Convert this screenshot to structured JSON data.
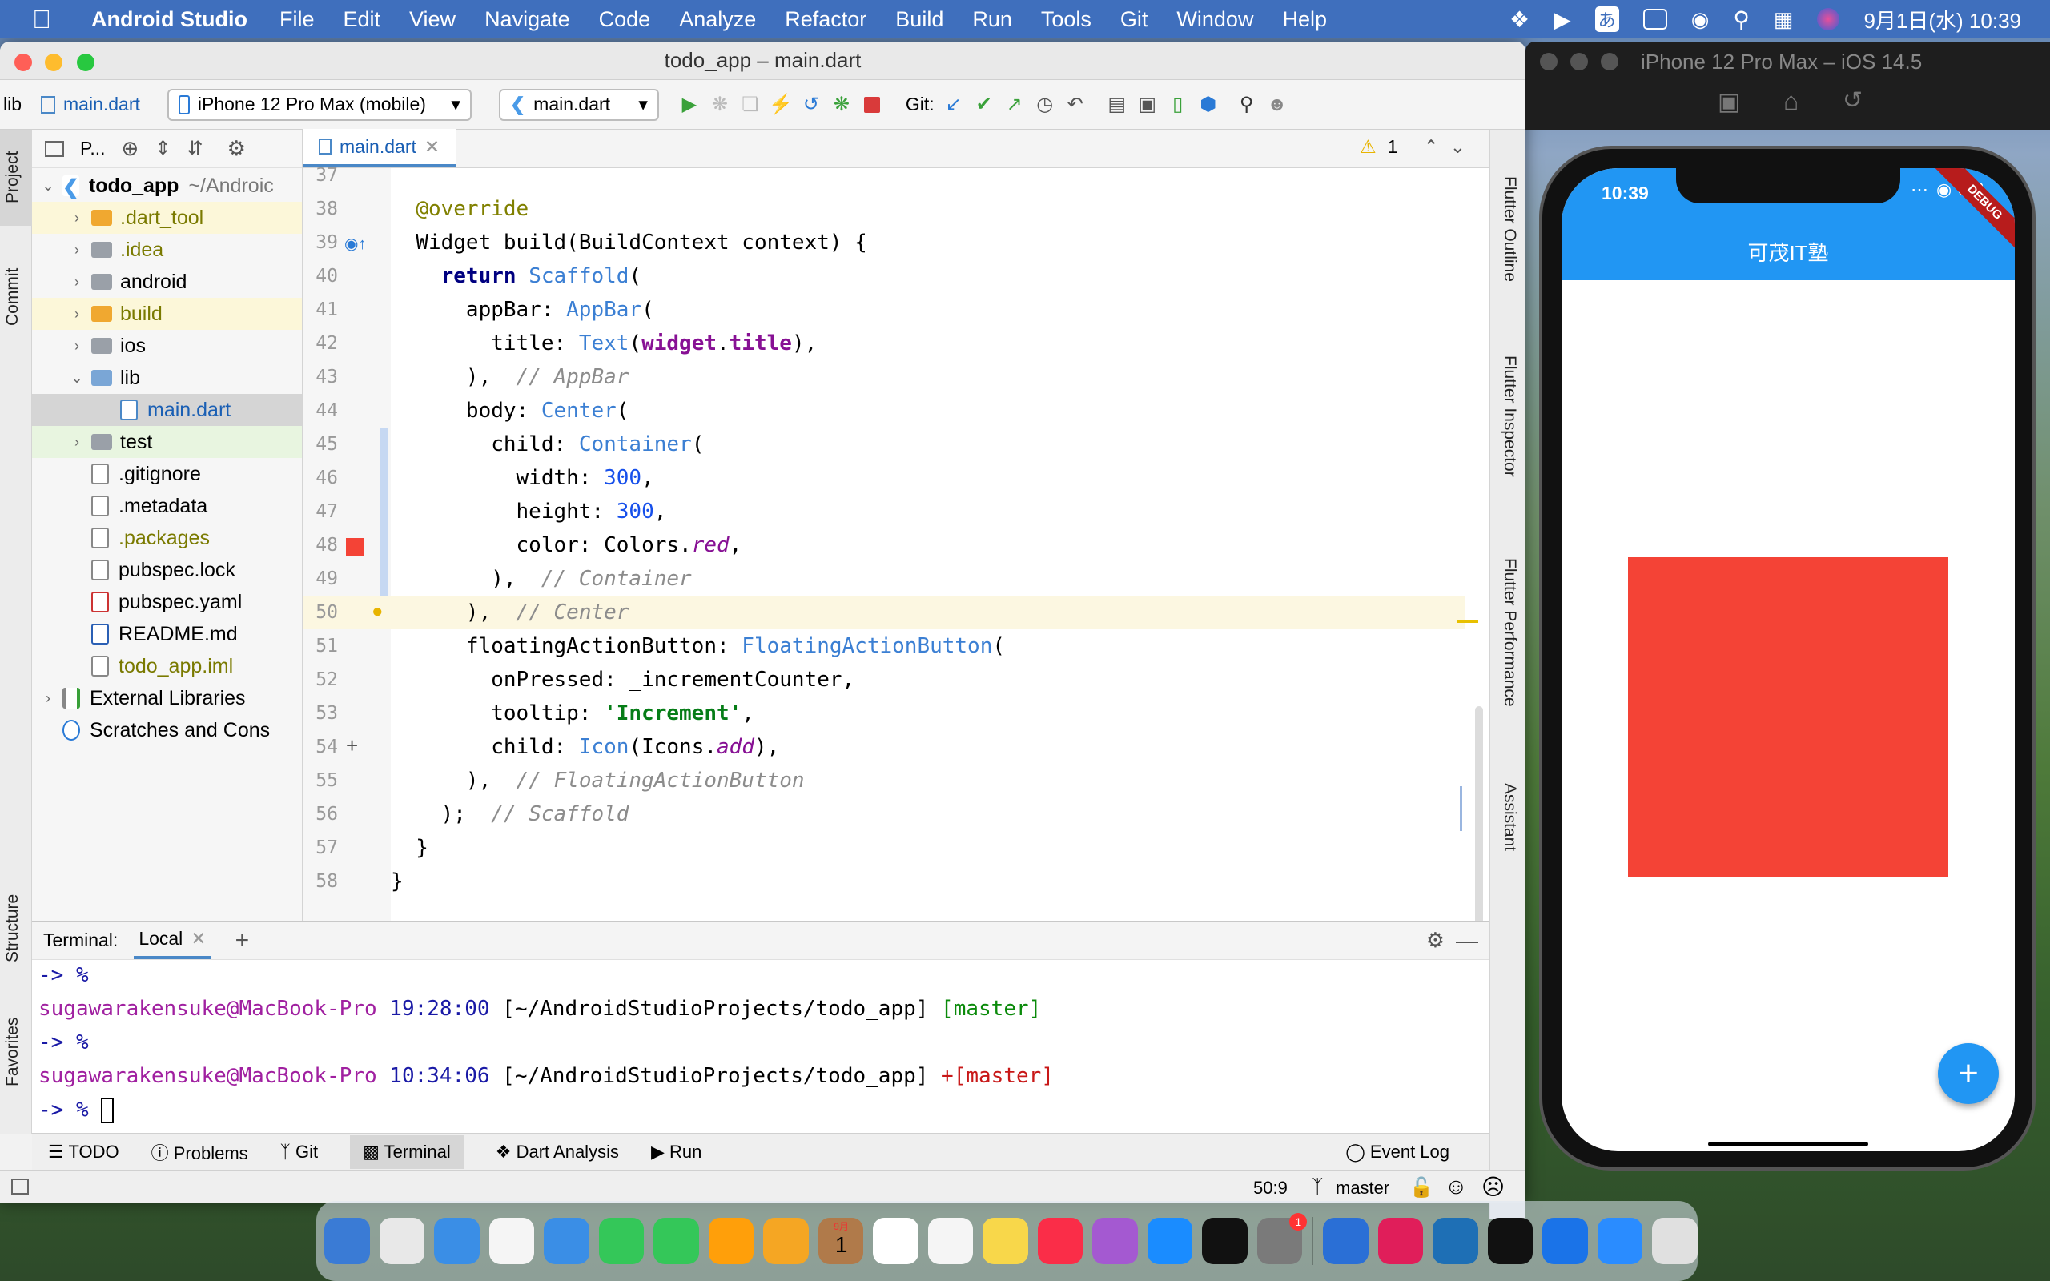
{
  "menubar": {
    "app": "Android Studio",
    "items": [
      "File",
      "Edit",
      "View",
      "Navigate",
      "Code",
      "Analyze",
      "Refactor",
      "Build",
      "Run",
      "Tools",
      "Git",
      "Window",
      "Help"
    ],
    "ime": "あ",
    "clock": "9月1日(水)  10:39"
  },
  "window": {
    "title": "todo_app – main.dart"
  },
  "toolbar": {
    "crumb_dir": "lib",
    "crumb_file": "main.dart",
    "device": "iPhone 12 Pro Max (mobile)",
    "run_config": "main.dart",
    "git_label": "Git:"
  },
  "left_tabs": {
    "project": "Project",
    "commit": "Commit",
    "structure": "Structure",
    "favorites": "Favorites"
  },
  "project_panel": {
    "header": "P...",
    "tree": [
      {
        "label": "todo_app",
        "extra": "~/Androic",
        "depth": 0,
        "arrow": "open",
        "icon": "flutter",
        "bold": true
      },
      {
        "label": ".dart_tool",
        "depth": 1,
        "arrow": "closed",
        "icon": "folder-orange",
        "color": "#7a7a00",
        "hl": "#fcf7d9"
      },
      {
        "label": ".idea",
        "depth": 1,
        "arrow": "closed",
        "icon": "folder-grey",
        "color": "#7a7a00"
      },
      {
        "label": "android",
        "depth": 1,
        "arrow": "closed",
        "icon": "folder-grey"
      },
      {
        "label": "build",
        "depth": 1,
        "arrow": "closed",
        "icon": "folder-orange",
        "color": "#7a7a00",
        "hl": "#fcf7d9"
      },
      {
        "label": "ios",
        "depth": 1,
        "arrow": "closed",
        "icon": "folder-grey"
      },
      {
        "label": "lib",
        "depth": 1,
        "arrow": "open",
        "icon": "folder-blue"
      },
      {
        "label": "main.dart",
        "depth": 2,
        "icon": "dart-file",
        "color": "#1a5fb4",
        "hl": "#d5d5d5"
      },
      {
        "label": "test",
        "depth": 1,
        "arrow": "closed",
        "icon": "folder-green",
        "hl": "#e8f5e0"
      },
      {
        "label": ".gitignore",
        "depth": 1,
        "icon": "file"
      },
      {
        "label": ".metadata",
        "depth": 1,
        "icon": "file"
      },
      {
        "label": ".packages",
        "depth": 1,
        "icon": "file",
        "color": "#7a7a00"
      },
      {
        "label": "pubspec.lock",
        "depth": 1,
        "icon": "file"
      },
      {
        "label": "pubspec.yaml",
        "depth": 1,
        "icon": "yaml-file"
      },
      {
        "label": "README.md",
        "depth": 1,
        "icon": "md-file"
      },
      {
        "label": "todo_app.iml",
        "depth": 1,
        "icon": "file",
        "color": "#7a7a00"
      },
      {
        "label": "External Libraries",
        "depth": 0,
        "arrow": "closed",
        "icon": "library"
      },
      {
        "label": "Scratches and Cons",
        "depth": 0,
        "icon": "scratch"
      }
    ]
  },
  "editor": {
    "tab": "main.dart",
    "warning_count": "1",
    "lines": [
      {
        "n": "37",
        "html": ""
      },
      {
        "n": "38",
        "html": "  <span class='an'>@override</span>"
      },
      {
        "n": "39",
        "html": "  Widget build(BuildContext context) {"
      },
      {
        "n": "40",
        "html": "    <span class='kw'>return</span> <span class='ty'>Scaffold</span>("
      },
      {
        "n": "41",
        "html": "      appBar: <span class='ty'>AppBar</span>("
      },
      {
        "n": "42",
        "html": "        title: <span class='ty'>Text</span>(<span class='pf'>widget</span>.<span class='pf'>title</span>),"
      },
      {
        "n": "43",
        "html": "      ),  <span class='cm'>// AppBar</span>"
      },
      {
        "n": "44",
        "html": "      body: <span class='ty'>Center</span>("
      },
      {
        "n": "45",
        "html": "        child: <span class='ty'>Container</span>("
      },
      {
        "n": "46",
        "html": "          width: <span class='num'>300</span>,"
      },
      {
        "n": "47",
        "html": "          height: <span class='num'>300</span>,"
      },
      {
        "n": "48",
        "html": "          color: Colors.<span class='it'>red</span>,"
      },
      {
        "n": "49",
        "html": "        ),  <span class='cm'>// Container</span>"
      },
      {
        "n": "50",
        "html": "      ),  <span class='cm'>// Center</span>"
      },
      {
        "n": "51",
        "html": "      floatingActionButton: <span class='ty'>FloatingActionButton</span>("
      },
      {
        "n": "52",
        "html": "        onPressed: _incrementCounter,"
      },
      {
        "n": "53",
        "html": "        tooltip: <span class='str'>'Increment'</span>,"
      },
      {
        "n": "54",
        "html": "        child: <span class='ty'>Icon</span>(Icons.<span class='it'>add</span>),"
      },
      {
        "n": "55",
        "html": "      ),  <span class='cm'>// FloatingActionButton</span>"
      },
      {
        "n": "56",
        "html": "    );  <span class='cm'>// Scaffold</span>"
      },
      {
        "n": "57",
        "html": "  }"
      },
      {
        "n": "58",
        "html": "}"
      }
    ]
  },
  "right_tabs": {
    "outline": "Flutter Outline",
    "inspector": "Flutter Inspector",
    "performance": "Flutter Performance",
    "assistant": "Assistant"
  },
  "terminal": {
    "label": "Terminal:",
    "tab": "Local",
    "lines": [
      [
        {
          "t": "-> %",
          "c": "blue"
        }
      ],
      [
        {
          "t": "sugawarakensuke@MacBook-Pro",
          "c": "purple"
        },
        {
          "t": " 19:28:00",
          "c": "blue"
        },
        {
          "t": " [~/AndroidStudioProjects/todo_app]",
          "c": ""
        },
        {
          "t": " [master]",
          "c": "green"
        }
      ],
      [
        {
          "t": "-> %",
          "c": "blue"
        }
      ],
      [
        {
          "t": "sugawarakensuke@MacBook-Pro",
          "c": "purple"
        },
        {
          "t": " 10:34:06",
          "c": "blue"
        },
        {
          "t": " [~/AndroidStudioProjects/todo_app]",
          "c": ""
        },
        {
          "t": " +[master]",
          "c": "red"
        }
      ],
      [
        {
          "t": "-> % ",
          "c": "blue"
        }
      ]
    ]
  },
  "toolwindows": [
    "TODO",
    "Problems",
    "Git",
    "Terminal",
    "Dart Analysis",
    "Run"
  ],
  "event_log": "Event Log",
  "status": {
    "position": "50:9",
    "branch": "master"
  },
  "simulator": {
    "title": "iPhone 12 Pro Max – iOS 14.5",
    "time": "10:39",
    "debug_banner": "DEBUG",
    "app_title": "可茂IT塾",
    "app_bar_color": "#2196f3",
    "container_color": "#f44336",
    "fab_symbol": "+"
  },
  "dock_colors": [
    "#3a7bd5",
    "#e8e8e8",
    "#3a8ee6",
    "#f5f5f5",
    "#3a8ee6",
    "#34c759",
    "#34c759",
    "#ff9f0a",
    "#f5a623",
    "#b07a4a",
    "#ffffff",
    "#f5f5f5",
    "#f8d74a",
    "#fa2d48",
    "#a459d1",
    "#1a8cff",
    "#111111",
    "#7a7a7a",
    "#2a6fd6",
    "#e01e5a",
    "#1e6fb5",
    "#111111",
    "#1a73e8",
    "#2a8cff",
    "#e0e0e0"
  ],
  "dock_badge": "1",
  "dock_calendar": {
    "month": "9月",
    "day": "1"
  }
}
